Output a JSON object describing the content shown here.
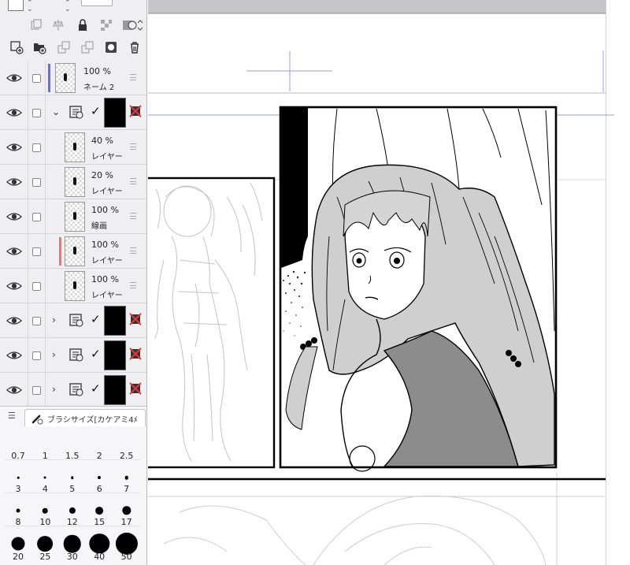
{
  "layers": [
    {
      "opacity": "100 %",
      "name": "ネーム 2",
      "color": "#6b6bdc"
    },
    {
      "type": "folder",
      "expanded": true
    },
    {
      "opacity": "40 %",
      "name": "レイヤー"
    },
    {
      "opacity": "20 %",
      "name": "レイヤー"
    },
    {
      "opacity": "100 %",
      "name": "線画"
    },
    {
      "opacity": "100 %",
      "name": "レイヤー",
      "color": "#e07a7a"
    },
    {
      "opacity": "100 %",
      "name": "レイヤー"
    },
    {
      "type": "folder",
      "expanded": false
    },
    {
      "type": "folder",
      "expanded": false
    },
    {
      "type": "folder",
      "expanded": false
    }
  ],
  "brush_panel": {
    "tab_label": "ブラシサイズ[カケアミ4ﾒ",
    "sizes": [
      "0.7",
      "1",
      "1.5",
      "2",
      "2.5",
      "3",
      "4",
      "5",
      "6",
      "7",
      "8",
      "10",
      "12",
      "15",
      "17",
      "20",
      "25",
      "30",
      "40",
      "50"
    ]
  },
  "icons": {
    "visibility": "eye-icon",
    "folder": "folder-icon",
    "mask_disabled": "mask-disabled-icon",
    "trash": "trash-icon",
    "lock": "lock-icon"
  }
}
